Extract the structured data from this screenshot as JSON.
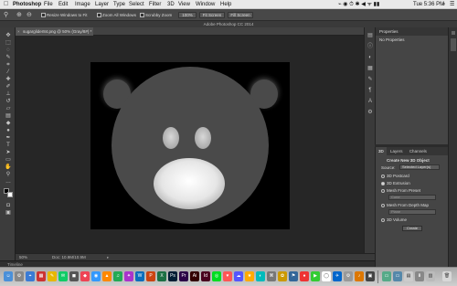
{
  "menubar": {
    "apple_icon": "apple-logo",
    "items": [
      "Photoshop",
      "File",
      "Edit",
      "Image",
      "Layer",
      "Type",
      "Select",
      "Filter",
      "3D",
      "View",
      "Window",
      "Help"
    ],
    "clock": "Tue 5:36 PM"
  },
  "options": {
    "resize_windows": "Resize Windows to Fit",
    "zoom_all": "Zoom All Windows",
    "scrubby_zoom": "Scrubby Zoom",
    "btn_100": "100%",
    "btn_fit": "Fit Screen",
    "btn_fill": "Fill Screen"
  },
  "app_title": "Adobe Photoshop CC 2014",
  "document": {
    "tab_label": "sugarglider84.png @ 50% (Gray/8#) *",
    "zoom": "50%",
    "doc_info": "Doc: 10.9M/10.9M"
  },
  "timeline_label": "Timeline",
  "properties": {
    "title": "Properties",
    "subtitle": "No Properties"
  },
  "threed": {
    "tabs": [
      "3D",
      "Layers",
      "Channels"
    ],
    "create_title": "Create New 3D Object",
    "source_label": "Source:",
    "source_value": "Selected Layer(s)",
    "options": [
      "3D Postcard",
      "3D Extrusion",
      "Mesh From Preset",
      "Mesh From Depth Map",
      "3D Volume"
    ],
    "preset_value": "Cone",
    "depth_value": "Plane",
    "create_button": "Create"
  },
  "colors": {
    "accent": "#3b83d6",
    "panel": "#454545",
    "canvas_bg": "#262626"
  }
}
